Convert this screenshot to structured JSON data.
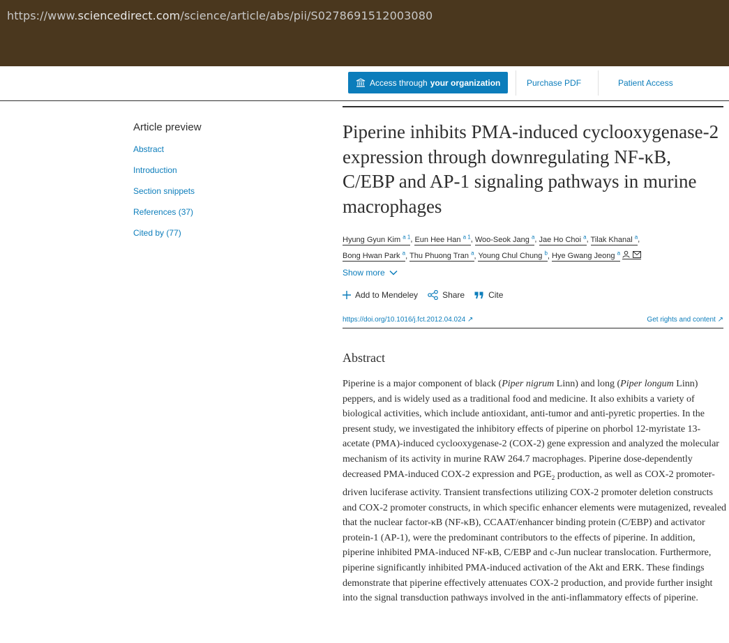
{
  "browser": {
    "url_prefix": "https://www.",
    "url_domain": "sciencedirect.com",
    "url_path": "/science/article/abs/pii/S0278691512003080"
  },
  "nav": {
    "access_label": "Access through",
    "access_bold": "your organization",
    "purchase_pdf": "Purchase PDF",
    "patient_access": "Patient Access"
  },
  "sidebar": {
    "heading": "Article preview",
    "items": [
      {
        "label": "Abstract"
      },
      {
        "label": "Introduction"
      },
      {
        "label": "Section snippets"
      },
      {
        "label": "References (37)"
      },
      {
        "label": "Cited by (77)"
      }
    ]
  },
  "article": {
    "title": "Piperine inhibits PMA-induced cyclooxygenase-2 expression through downregulating NF-κB, C/EBP and AP-1 signaling pathways in murine macrophages",
    "authors": [
      {
        "name": "Hyung Gyun Kim",
        "aff": "a 1"
      },
      {
        "name": "Eun Hee Han",
        "aff": "a 1"
      },
      {
        "name": "Woo-Seok Jang",
        "aff": "a"
      },
      {
        "name": "Jae Ho Choi",
        "aff": "a"
      },
      {
        "name": "Tilak Khanal",
        "aff": "a"
      },
      {
        "name": "Bong Hwan Park",
        "aff": "a"
      },
      {
        "name": "Thu Phuong Tran",
        "aff": "a"
      },
      {
        "name": "Young Chul Chung",
        "aff": "b"
      },
      {
        "name": "Hye Gwang Jeong",
        "aff": "a"
      }
    ],
    "show_more": "Show more",
    "actions": {
      "mendeley": "Add to Mendeley",
      "share": "Share",
      "cite": "Cite"
    },
    "doi": "https://doi.org/10.1016/j.fct.2012.04.024",
    "rights": "Get rights and content"
  },
  "abstract": {
    "heading": "Abstract",
    "p1": "Piperine is a major component of black (",
    "i1": "Piper nigrum",
    "p2": " Linn) and long (",
    "i2": "Piper longum",
    "p3": " Linn) peppers, and is widely used as a traditional food and medicine. It also exhibits a variety of biological activities, which include antioxidant, anti-tumor and anti-pyretic properties. In the present study, we investigated the inhibitory effects of piperine on phorbol 12-myristate 13-acetate (PMA)-induced cyclooxygenase-2 (COX-2) gene expression and analyzed the molecular mechanism of its activity in murine RAW 264.7 macrophages. Piperine dose-dependently decreased PMA-induced COX-2 expression and PGE",
    "sub": "2",
    "p4": " production, as well as COX-2 promoter-driven luciferase activity. Transient transfections utilizing COX-2 promoter deletion constructs and COX-2 promoter constructs, in which specific enhancer elements were mutagenized, revealed that the nuclear factor-κB (NF-κB), CCAAT/enhancer binding protein (C/EBP) and activator protein-1 (AP-1), were the predominant contributors to the effects of piperine. In addition, piperine inhibited PMA-induced NF-κB, C/EBP and c-Jun nuclear translocation. Furthermore, piperine significantly inhibited PMA-induced activation of the Akt and ERK. These findings demonstrate that piperine effectively attenuates COX-2 production, and provide further insight into the signal transduction pathways involved in the anti-inflammatory effects of piperine."
  }
}
